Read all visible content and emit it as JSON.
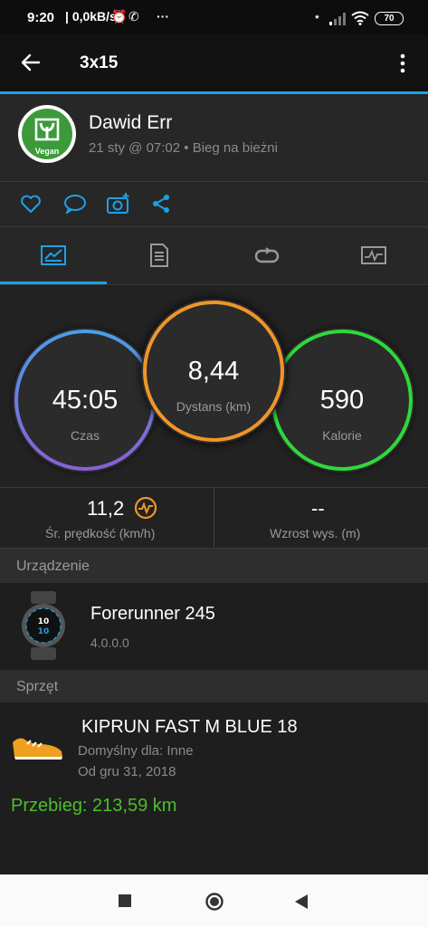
{
  "status_bar": {
    "time": "9:20",
    "net_speed": "0,0kB/s",
    "overflow": "···",
    "battery": "70"
  },
  "app_bar": {
    "title": "3x15",
    "back_icon": "arrow-left-icon",
    "menu_icon": "more-vertical-icon"
  },
  "activity": {
    "user_name": "Dawid Err",
    "avatar_text": "Vegan",
    "meta": "21 sty @ 07:02 • Bieg na bieżni"
  },
  "actions": [
    "heart-icon",
    "comment-icon",
    "camera-plus-icon",
    "share-icon"
  ],
  "tabs": [
    "stats-tab-icon",
    "details-tab-icon",
    "laps-tab-icon",
    "chart-tab-icon"
  ],
  "circles": {
    "time": {
      "value": "45:05",
      "label": "Czas"
    },
    "distance": {
      "value": "8,44",
      "label": "Dystans (km)"
    },
    "calories": {
      "value": "590",
      "label": "Kalorie"
    }
  },
  "metrics": {
    "speed": {
      "value": "11,2",
      "label": "Śr. prędkość (km/h)"
    },
    "elevation": {
      "value": "--",
      "label": "Wzrost wys. (m)"
    }
  },
  "device_section": {
    "title": "Urządzenie",
    "name": "Forerunner 245",
    "version": "4.0.0.0"
  },
  "gear_section": {
    "title": "Sprzęt",
    "name": "KIPRUN FAST M BLUE 18",
    "default_for": "Domyślny dla: Inne",
    "since": "Od gru 31, 2018",
    "mileage": "Przebieg: 213,59 km"
  },
  "colors": {
    "accent": "#1da1e5",
    "time_ring": "#5b8fe0",
    "distance_ring": "#f0952a",
    "calories_ring": "#2ed93a",
    "mileage_text": "#4cbf2a"
  }
}
